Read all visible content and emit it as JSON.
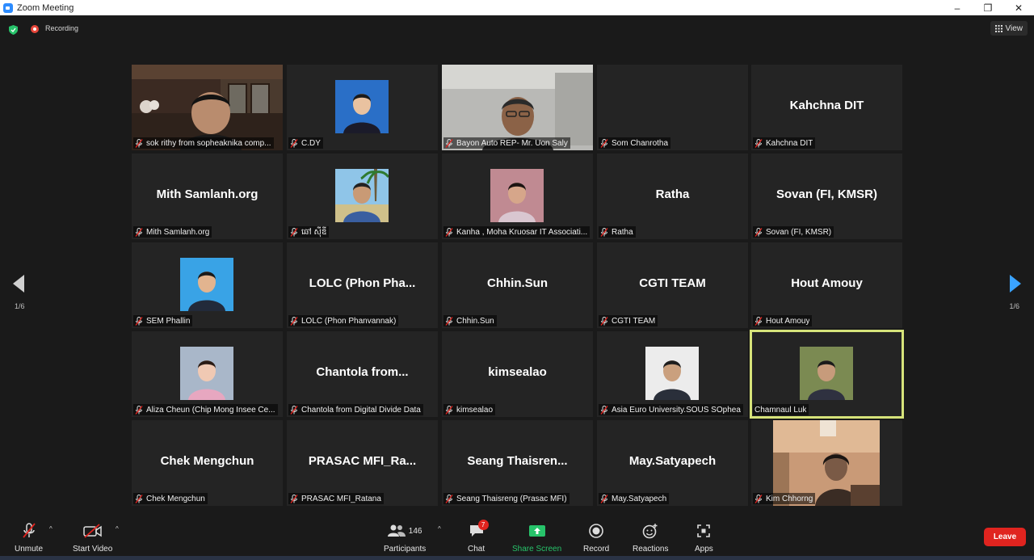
{
  "window": {
    "title": "Zoom Meeting",
    "minimize": "–",
    "restore": "❐",
    "close": "✕"
  },
  "topbar": {
    "recording_label": "Recording",
    "view_label": "View"
  },
  "pagination": {
    "left_page": "1/6",
    "right_page": "1/6"
  },
  "tiles": [
    {
      "name": "sok rithy from sopheaknika comp...",
      "big": "",
      "type": "video-room"
    },
    {
      "name": "C.DY",
      "big": "",
      "type": "avatar-suit"
    },
    {
      "name": "Bayon Auto REP- Mr. Uon Saly",
      "big": "",
      "type": "video-man"
    },
    {
      "name": "Som Chanrotha",
      "big": "",
      "type": "blank"
    },
    {
      "name": "Kahchna DIT",
      "big": "Kahchna DIT",
      "type": "text"
    },
    {
      "name": "Mith Samlanh.org",
      "big": "Mith Samlanh.org",
      "type": "text"
    },
    {
      "name": "ឆៅ ស៊ីឌី",
      "big": "",
      "type": "avatar-beach"
    },
    {
      "name": "Kanha , Moha Kruosar IT Associati...",
      "big": "",
      "type": "avatar-girl"
    },
    {
      "name": "Ratha",
      "big": "Ratha",
      "type": "text"
    },
    {
      "name": "Sovan (FI, KMSR)",
      "big": "Sovan (FI, KMSR)",
      "type": "text"
    },
    {
      "name": "SEM Phallin",
      "big": "",
      "type": "avatar-blue"
    },
    {
      "name": "LOLC (Phon Phanvannak)",
      "big": "LOLC (Phon Pha...",
      "type": "text"
    },
    {
      "name": "Chhin.Sun",
      "big": "Chhin.Sun",
      "type": "text"
    },
    {
      "name": "CGTI TEAM",
      "big": "CGTI TEAM",
      "type": "text"
    },
    {
      "name": "Hout Amouy",
      "big": "Hout Amouy",
      "type": "text"
    },
    {
      "name": "Aliza Cheun (Chip Mong Insee Ce...",
      "big": "",
      "type": "avatar-girl2"
    },
    {
      "name": "Chantola from Digital Divide Data",
      "big": "Chantola from...",
      "type": "text"
    },
    {
      "name": "kimsealao",
      "big": "kimsealao",
      "type": "text"
    },
    {
      "name": "Asia Euro University.SOUS SOphea",
      "big": "",
      "type": "avatar-suit2"
    },
    {
      "name": "Chamnaul Luk",
      "big": "",
      "type": "avatar-outdoor",
      "active": true
    },
    {
      "name": "Chek Mengchun",
      "big": "Chek Mengchun",
      "type": "text"
    },
    {
      "name": "PRASAC MFI_Ratana",
      "big": "PRASAC MFI_Ra...",
      "type": "text"
    },
    {
      "name": "Seang Thaisreng (Prasac MFI)",
      "big": "Seang Thaisren...",
      "type": "text"
    },
    {
      "name": "May.Satyapech",
      "big": "May.Satyapech",
      "type": "text"
    },
    {
      "name": "Kim Chhorng",
      "big": "",
      "type": "video-woman"
    }
  ],
  "toolbar": {
    "unmute": "Unmute",
    "start_video": "Start Video",
    "participants": "Participants",
    "participants_count": "146",
    "chat": "Chat",
    "chat_badge": "7",
    "share_screen": "Share Screen",
    "record": "Record",
    "reactions": "Reactions",
    "apps": "Apps",
    "leave": "Leave"
  },
  "colors": {
    "accent_blue": "#3aa3ff",
    "share_green": "#27c36a",
    "leave_red": "#e0241f",
    "active_speaker": "#d6e37a"
  }
}
